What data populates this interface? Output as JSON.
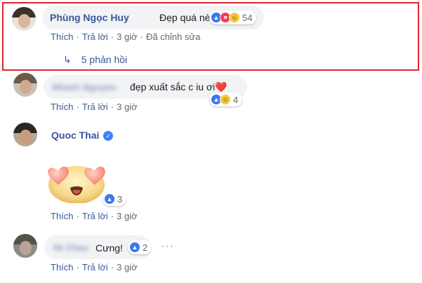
{
  "comments": [
    {
      "author": "Phùng Ngọc Huy",
      "text": "Đẹp quá nè...",
      "reaction_count": "54",
      "actions": {
        "like": "Thích",
        "reply": "Trả lời",
        "time": "3 giờ",
        "edited": "Đã chỉnh sửa"
      },
      "replies_link": "5 phản hồi"
    },
    {
      "author": "Nhanh Nguyen",
      "text": "đẹp xuất sắc c iu ơi",
      "heart": "❤️",
      "reaction_count": "4",
      "actions": {
        "like": "Thích",
        "reply": "Trả lời",
        "time": "3 giờ"
      }
    },
    {
      "author": "Quoc Thai",
      "reaction_count": "3",
      "actions": {
        "like": "Thích",
        "reply": "Trả lời",
        "time": "3 giờ"
      }
    },
    {
      "author": "Nt Chau",
      "text": "Cưng!",
      "reaction_count": "2",
      "more": "···",
      "actions": {
        "like": "Thích",
        "reply": "Trả lời",
        "time": "3 giờ"
      }
    }
  ],
  "icons": {
    "like": "like-reaction-icon",
    "love": "love-reaction-icon",
    "haha": "haha-reaction-icon",
    "reply_arrow": "reply-arrow-icon",
    "verified": "verified-badge-icon"
  },
  "colors": {
    "link": "#385898",
    "highlight_border": "#e0242c",
    "bubble": "#f2f3f5",
    "like": "#3b78f0",
    "love": "#f33e58",
    "haha": "#f7c934"
  }
}
